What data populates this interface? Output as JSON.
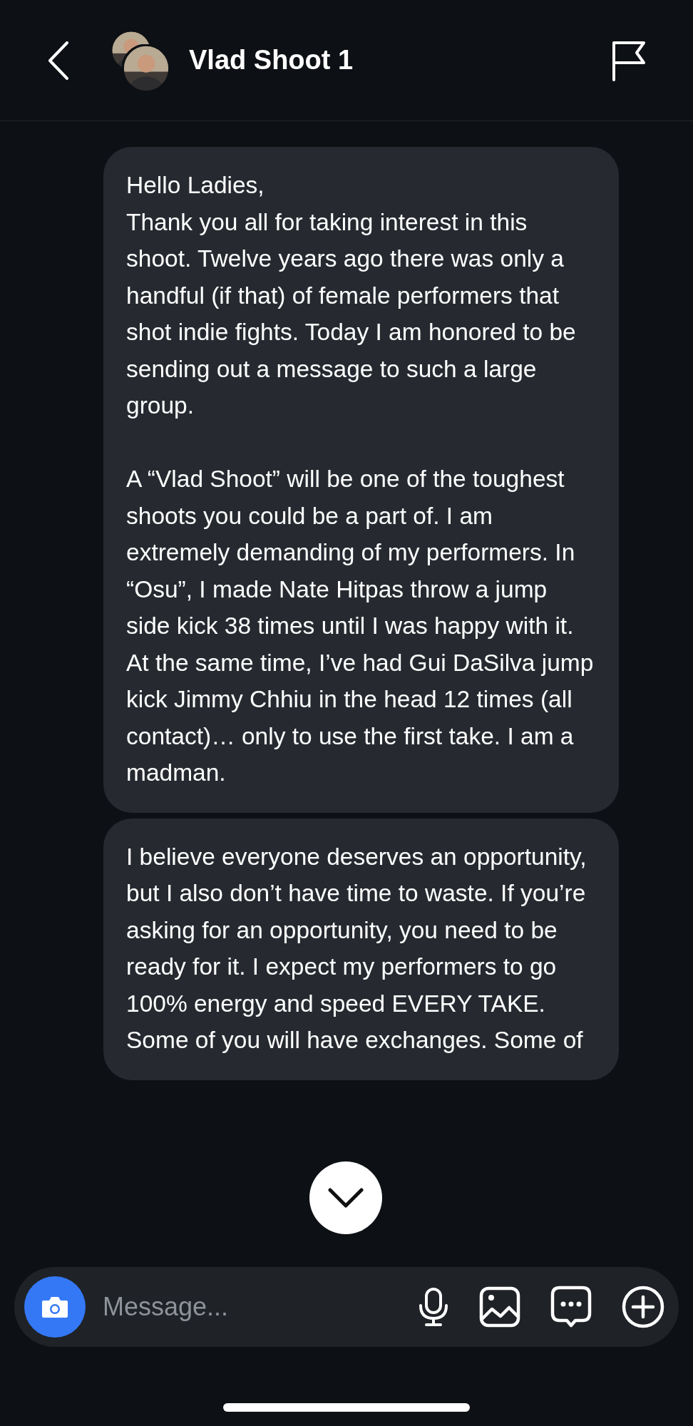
{
  "header": {
    "title": "Vlad Shoot 1"
  },
  "messages": [
    {
      "text": "Hello Ladies,\nThank you all for taking interest in this shoot. Twelve years ago there was only a handful (if that) of female performers that shot indie fights. Today I am honored to be sending out a message to such a large group.\n\nA “Vlad Shoot” will be one of the toughest shoots you could be a part of. I am extremely demanding of my performers. In “Osu”, I made Nate Hitpas throw a jump side kick 38 times until I was happy with it. At the same time, I’ve had Gui DaSilva jump kick Jimmy Chhiu in the head 12 times (all contact)… only to use the first take. I am a madman."
    },
    {
      "text": "I believe everyone deserves an opportunity, but I also don’t have time to waste. If you’re asking for an opportunity, you need to be ready for it.  I expect my performers to go 100% energy and speed EVERY TAKE. Some of you will have exchanges. Some of"
    }
  ],
  "composer": {
    "placeholder": "Message..."
  }
}
